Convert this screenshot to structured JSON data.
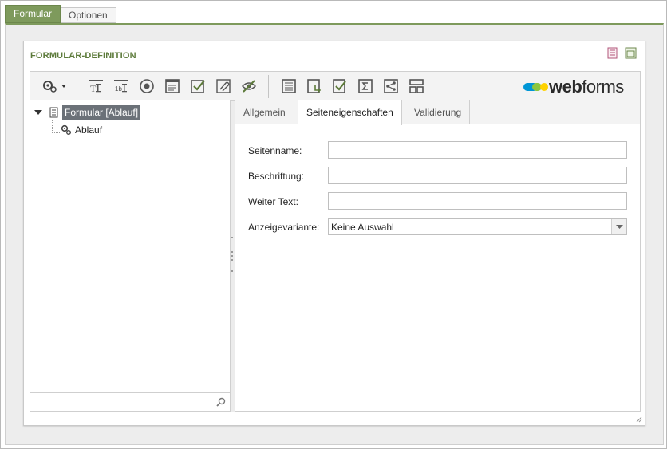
{
  "top_tabs": [
    {
      "label": "Formular",
      "active": true
    },
    {
      "label": "Optionen",
      "active": false
    }
  ],
  "panel": {
    "title": "FORMULAR-DEFINITION"
  },
  "toolbar": {
    "settings_menu_icon": "gears-dropdown-icon",
    "buttons": [
      "text-field-icon",
      "labeled-text-field-icon",
      "radio-button-icon",
      "text-area-icon",
      "checkbox-icon",
      "attachment-icon",
      "hidden-field-icon",
      "page-icon",
      "page-break-icon",
      "validation-icon",
      "calculation-icon",
      "flow-icon",
      "layout-icon"
    ]
  },
  "brand": {
    "name_bold": "web",
    "name_regular": "forms",
    "colors": [
      "#0096d6",
      "#8cc63f",
      "#ffd200"
    ]
  },
  "tree": {
    "root_label": "Formular [Ablauf]",
    "child_label": "Ablauf",
    "search_placeholder": ""
  },
  "form_tabs": [
    {
      "label": "Allgemein",
      "active": false
    },
    {
      "label": "Seiteneigenschaften",
      "active": true
    },
    {
      "label": "Validierung",
      "active": false
    }
  ],
  "form": {
    "fields": [
      {
        "label": "Seitenname:",
        "value": ""
      },
      {
        "label": "Beschriftung:",
        "value": ""
      },
      {
        "label": "Weiter Text:",
        "value": ""
      }
    ],
    "select_label": "Anzeigevariante:",
    "select_value": "Keine Auswahl"
  },
  "colors": {
    "accent": "#7e9a5c",
    "title": "#5c7a3a",
    "selection": "#6b7178"
  }
}
